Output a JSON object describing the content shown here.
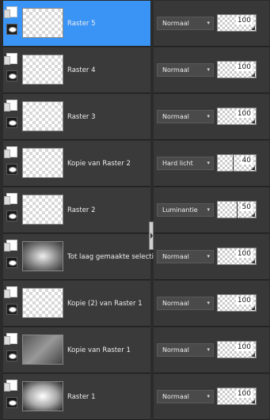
{
  "layers": [
    {
      "name": "Raster 5",
      "blend": "Normaal",
      "opacity": "100",
      "selected": true,
      "thumb": "checker"
    },
    {
      "name": "Raster 4",
      "blend": "Normaal",
      "opacity": "100",
      "selected": false,
      "thumb": "checker"
    },
    {
      "name": "Raster 3",
      "blend": "Normaal",
      "opacity": "100",
      "selected": false,
      "thumb": "checker"
    },
    {
      "name": "Kopie van Raster 2",
      "blend": "Hard licht",
      "opacity": "40",
      "selected": false,
      "thumb": "checker"
    },
    {
      "name": "Raster 2",
      "blend": "Luminantie",
      "opacity": "50",
      "selected": false,
      "thumb": "checker"
    },
    {
      "name": "Tot laag gemaakte selectie",
      "blend": "Normaal",
      "opacity": "100",
      "selected": false,
      "thumb": "x"
    },
    {
      "name": "Kopie (2) van Raster 1",
      "blend": "Normaal",
      "opacity": "100",
      "selected": false,
      "thumb": "checker"
    },
    {
      "name": "Kopie van Raster 1",
      "blend": "Normaal",
      "opacity": "100",
      "selected": false,
      "thumb": "dark"
    },
    {
      "name": "Raster 1",
      "blend": "Normaal",
      "opacity": "100",
      "selected": false,
      "thumb": "glow"
    }
  ]
}
